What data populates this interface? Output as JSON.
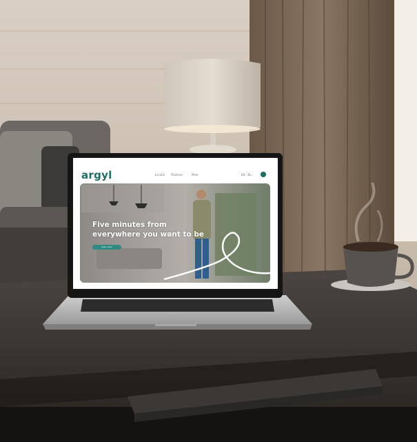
{
  "website": {
    "logo": "argyl",
    "nav": [
      "Locatie",
      "Plaatsen",
      "Meer"
    ],
    "lang": "EN · NL ·",
    "headline_line1": "Five minutes from",
    "headline_line2": "everywhere you want to be",
    "cta_label": "Lees meer"
  },
  "colors": {
    "brand_green": "#1f6e63",
    "cta_green": "#2f8a80"
  }
}
